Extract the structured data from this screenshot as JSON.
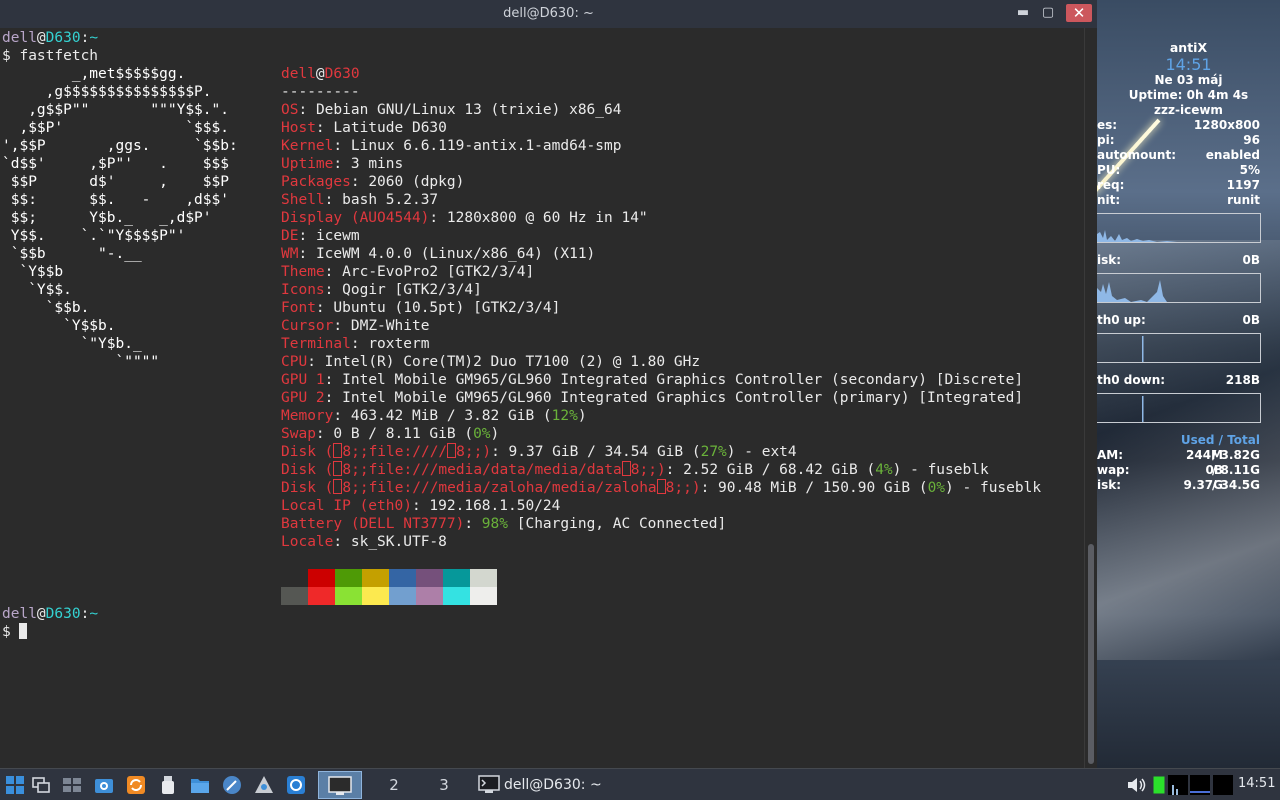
{
  "window": {
    "title": "dell@D630: ~"
  },
  "prompt": {
    "user": "dell",
    "at": "@",
    "host": "D630",
    "colon": ":",
    "path": "~",
    "sign": "$"
  },
  "commands": {
    "first": "fastfetch"
  },
  "logo_lines": [
    "        _,met$$$$$gg.",
    "     ,g$$$$$$$$$$$$$$$P.",
    "   ,g$$P\"\"       \"\"\"Y$$.\".",
    "  ,$$P'              `$$$.",
    "',$$P       ,ggs.     `$$b:",
    "`d$$'     ,$P\"'   .    $$$",
    " $$P      d$'     ,    $$P",
    " $$:      $$.   -    ,d$$'",
    " $$;      Y$b._   _,d$P'",
    " Y$$.    `.`\"Y$$$$P\"'",
    " `$$b      \"-.__",
    "  `Y$$b",
    "   `Y$$.",
    "     `$$b.",
    "       `Y$$b.",
    "         `\"Y$b._",
    "             `\"\"\"\""
  ],
  "header": {
    "user": "dell",
    "at": "@",
    "host": "D630",
    "separator": "---------"
  },
  "info": [
    {
      "key": "OS",
      "value": "Debian GNU/Linux 13 (trixie) x86_64"
    },
    {
      "key": "Host",
      "value": "Latitude D630"
    },
    {
      "key": "Kernel",
      "value": "Linux 6.6.119-antix.1-amd64-smp"
    },
    {
      "key": "Uptime",
      "value": "3 mins"
    },
    {
      "key": "Packages",
      "value": "2060 (dpkg)"
    },
    {
      "key": "Shell",
      "value": "bash 5.2.37"
    },
    {
      "key": "Display (AUO4544)",
      "value": "1280x800 @ 60 Hz in 14\""
    },
    {
      "key": "DE",
      "value": "icewm"
    },
    {
      "key": "WM",
      "value": "IceWM 4.0.0 (Linux/x86_64) (X11)"
    },
    {
      "key": "Theme",
      "value": "Arc-EvoPro2 [GTK2/3/4]"
    },
    {
      "key": "Icons",
      "value": "Qogir [GTK2/3/4]"
    },
    {
      "key": "Font",
      "value": "Ubuntu (10.5pt) [GTK2/3/4]"
    },
    {
      "key": "Cursor",
      "value": "DMZ-White"
    },
    {
      "key": "Terminal",
      "value": "roxterm"
    },
    {
      "key": "CPU",
      "value": "Intel(R) Core(TM)2 Duo T7100 (2) @ 1.80 GHz"
    },
    {
      "key": "GPU 1",
      "value": "Intel Mobile GM965/GL960 Integrated Graphics Controller (secondary) [Discrete]"
    },
    {
      "key": "GPU 2",
      "value": "Intel Mobile GM965/GL960 Integrated Graphics Controller (primary) [Integrated]"
    }
  ],
  "memory": {
    "key": "Memory",
    "value": "463.42 MiB / 3.82 GiB (",
    "pct": "12%",
    "tail": ")"
  },
  "swap": {
    "key": "Swap",
    "value": "0 B / 8.11 GiB (",
    "pct": "0%",
    "tail": ")"
  },
  "disks": [
    {
      "key": "Disk (",
      "mid1": "8;;file:////",
      "mid2": "8;;)",
      "value": ": 9.37 GiB / 34.54 GiB (",
      "pct": "27%",
      "tail": ") - ext4"
    },
    {
      "key": "Disk (",
      "mid1": "8;;file:///media/data/media/data",
      "mid2": "8;;)",
      "value": ": 2.52 GiB / 68.42 GiB (",
      "pct": "4%",
      "tail": ") - fuseblk"
    },
    {
      "key": "Disk (",
      "mid1": "8;;file:///media/zaloha/media/zaloha",
      "mid2": "8;;)",
      "value": ": 90.48 MiB / 150.90 GiB (",
      "pct": "0%",
      "tail": ") - fuseblk"
    }
  ],
  "local_ip": {
    "key": "Local IP (eth0)",
    "value": "192.168.1.50/24"
  },
  "battery": {
    "key": "Battery (DELL NT3777)",
    "pct": "98%",
    "value": " [Charging, AC Connected]"
  },
  "locale": {
    "key": "Locale",
    "value": "sk_SK.UTF-8"
  },
  "palette": {
    "row1": [
      "#2b2b2b",
      "#cc0000",
      "#4e9a06",
      "#c4a000",
      "#3465a4",
      "#75507b",
      "#06989a",
      "#d3d7cf"
    ],
    "row2": [
      "#555753",
      "#ef2929",
      "#8ae234",
      "#fce94f",
      "#729fcf",
      "#ad7fa8",
      "#34e2e2",
      "#eeeeec"
    ]
  },
  "conky": {
    "distro": "antiX",
    "time": "14:51",
    "date": "Ne 03 máj",
    "uptime": "Uptime: 0h 4m 4s",
    "session": "zzz-icewm",
    "rows": [
      {
        "label": "es:",
        "value": "1280x800"
      },
      {
        "label": "pi:",
        "value": "96"
      },
      {
        "label": "automount:",
        "value": "enabled"
      },
      {
        "label": "PU:",
        "value": "5%"
      },
      {
        "label": "req:",
        "value": "1197"
      },
      {
        "label": "nit:",
        "value": "runit"
      }
    ],
    "disk_label": "isk:",
    "disk_value": "0B",
    "eth_up_label": "th0 up:",
    "eth_up_value": "0B",
    "eth_down_label": "th0 down:",
    "eth_down_value": "218B",
    "used": "Used",
    "slash": " / ",
    "total": "Total",
    "mem_rows": [
      {
        "label": "AM:",
        "used": "244M",
        "total": "/ 3.82G"
      },
      {
        "label": "wap:",
        "used": "0B",
        "total": "/ 8.11G"
      },
      {
        "label": "isk:",
        "used": "9.37G",
        "total": "/ 34.5G"
      }
    ]
  },
  "taskbar": {
    "workspaces": [
      "1",
      "2",
      "3"
    ],
    "task_label": "dell@D630: ~",
    "clock": "14:51"
  }
}
